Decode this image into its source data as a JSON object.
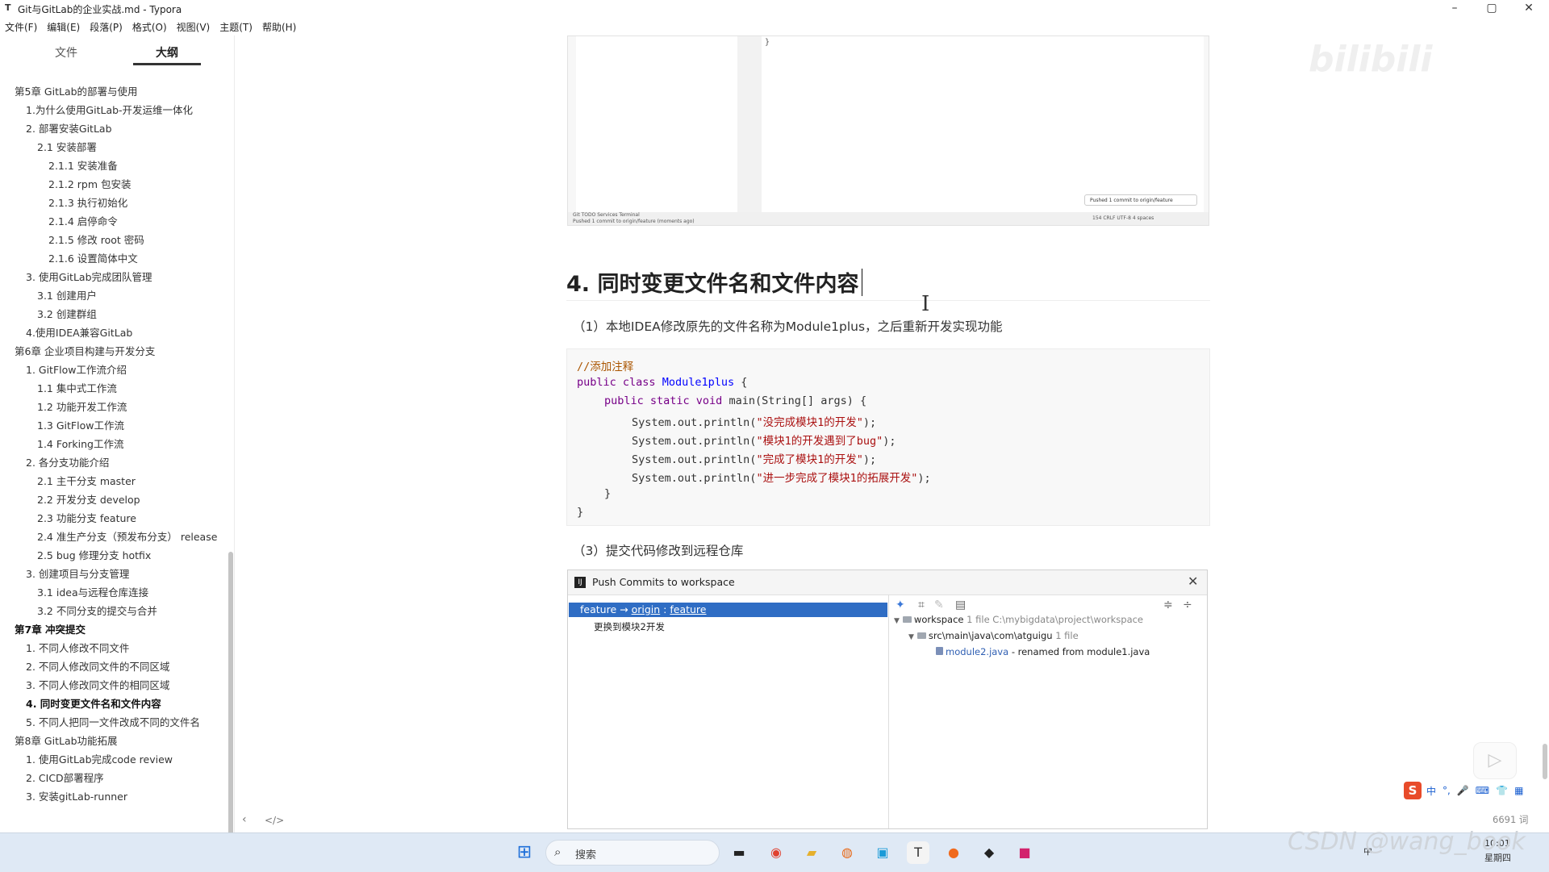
{
  "window": {
    "title": "Git与GitLab的企业实战.md - Typora",
    "app_icon": "T",
    "minimize": "–",
    "maximize": "▢",
    "close": "✕"
  },
  "menu": [
    "文件(F)",
    "编辑(E)",
    "段落(P)",
    "格式(O)",
    "视图(V)",
    "主题(T)",
    "帮助(H)"
  ],
  "sidebar": {
    "tab_files": "文件",
    "tab_outline": "大纲",
    "outline": [
      {
        "label": "第5章 GitLab的部署与使用",
        "level": 1
      },
      {
        "label": "1.为什么使用GitLab-开发运维一体化",
        "level": 2
      },
      {
        "label": "2. 部署安装GitLab",
        "level": 2
      },
      {
        "label": "2.1 安装部署",
        "level": 3
      },
      {
        "label": "2.1.1 安装准备",
        "level": 4
      },
      {
        "label": "2.1.2 rpm 包安装",
        "level": 4
      },
      {
        "label": "2.1.3 执行初始化",
        "level": 4
      },
      {
        "label": "2.1.4 启停命令",
        "level": 4
      },
      {
        "label": "2.1.5 修改 root 密码",
        "level": 4
      },
      {
        "label": "2.1.6 设置简体中文",
        "level": 4
      },
      {
        "label": "3. 使用GitLab完成团队管理",
        "level": 2
      },
      {
        "label": "3.1 创建用户",
        "level": 3
      },
      {
        "label": "3.2 创建群组",
        "level": 3
      },
      {
        "label": "4.使用IDEA兼容GitLab",
        "level": 2
      },
      {
        "label": "第6章 企业项目构建与开发分支",
        "level": 1
      },
      {
        "label": "1. GitFlow工作流介绍",
        "level": 2
      },
      {
        "label": "1.1 集中式工作流",
        "level": 3
      },
      {
        "label": "1.2 功能开发工作流",
        "level": 3
      },
      {
        "label": "1.3 GitFlow工作流",
        "level": 3
      },
      {
        "label": "1.4 Forking工作流",
        "level": 3
      },
      {
        "label": "2. 各分支功能介绍",
        "level": 2
      },
      {
        "label": "2.1 主干分支 master",
        "level": 3
      },
      {
        "label": "2.2 开发分支 develop",
        "level": 3
      },
      {
        "label": "2.3 功能分支 feature",
        "level": 3
      },
      {
        "label": "2.4 准生产分支（预发布分支） release",
        "level": 3,
        "wrap": true
      },
      {
        "label": "2.5 bug 修理分支 hotfix",
        "level": 3
      },
      {
        "label": "3. 创建项目与分支管理",
        "level": 2
      },
      {
        "label": "3.1 idea与远程仓库连接",
        "level": 3
      },
      {
        "label": "3.2 不同分支的提交与合并",
        "level": 3
      },
      {
        "label": "第7章 冲突提交",
        "level": 1,
        "bold": true
      },
      {
        "label": "1. 不同人修改不同文件",
        "level": 2
      },
      {
        "label": "2. 不同人修改同文件的不同区域",
        "level": 2
      },
      {
        "label": "3. 不同人修改同文件的相同区域",
        "level": 2
      },
      {
        "label": "4. 同时变更文件名和文件内容",
        "level": 2,
        "active": true
      },
      {
        "label": "5. 不同人把同一文件改成不同的文件名",
        "level": 2,
        "wrap": true
      },
      {
        "label": "第8章 GitLab功能拓展",
        "level": 1
      },
      {
        "label": "1. 使用GitLab完成code review",
        "level": 2
      },
      {
        "label": "2. CICD部署程序",
        "level": 2
      },
      {
        "label": "3. 安装gitLab-runner",
        "level": 2
      }
    ],
    "back_icon": "‹",
    "source_icon": "</>"
  },
  "ide_screenshot": {
    "brace": "}",
    "toast": "Pushed 1 commit to origin/feature",
    "status_tabs": "Git   TODO   Services   Terminal",
    "status_text": "Pushed 1 commit to origin/feature (moments ago)",
    "status_right": "154  CRLF  UTF-8  4 spaces"
  },
  "main": {
    "heading": "4. 同时变更文件名和文件内容",
    "step1": "（1）本地IDEA修改原先的文件名称为Module1plus，之后重新开发实现功能",
    "code": {
      "comment": "//添加注释",
      "class_kw": "public class",
      "class_name": "Module1plus",
      "open1": " {",
      "method_kw": "public static void",
      "method_sig": " main(String[] args) {",
      "println_prefix": "System.out.println(",
      "println_suffix": ");",
      "strings": [
        "\"没完成模块1的开发\"",
        "\"模块1的开发遇到了bug\"",
        "\"完成了模块1的开发\"",
        "\"进一步完成了模块1的拓展开发\""
      ],
      "close_inner": "}",
      "close_outer": "}"
    },
    "step3": "（3）提交代码修改到远程仓库"
  },
  "push_dialog": {
    "title": "Push Commits to workspace",
    "branch_local": "feature",
    "arrow": "→",
    "remote": "origin",
    "colon": " : ",
    "branch_remote": "feature",
    "commit_message": "更换到模块2开发",
    "tree_root": "workspace",
    "tree_root_meta": "1 file  C:\\mybigdata\\project\\workspace",
    "tree_folder": "src\\main\\java\\com\\atguigu",
    "tree_folder_meta": "1 file",
    "tree_file": "module2.java",
    "tree_file_meta": "- renamed from module1.java",
    "close_icon": "✕"
  },
  "overlay": {
    "watermark": "bilibili",
    "ime_logo": "S",
    "ime_mode": "中",
    "ime_punct": "°,",
    "word_count": "6691 词",
    "csdn": "CSDN @wang_book"
  },
  "taskbar": {
    "search_label": "搜索",
    "clock_time": "10:01",
    "clock_day": "星期四",
    "tray_lang": "中"
  },
  "colors": {
    "selection_blue": "#2f6dc4",
    "code_comment": "#aa5500",
    "code_keyword": "#770088",
    "code_string": "#aa1111",
    "taskbar": "#dfe9f5"
  }
}
